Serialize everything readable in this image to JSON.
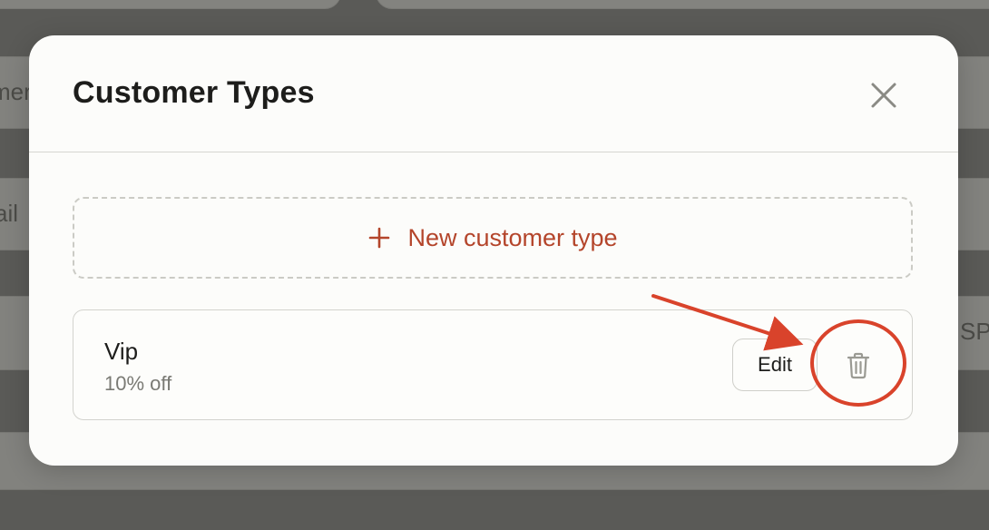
{
  "background": {
    "fragments": [
      "mer",
      "ail",
      "SP"
    ]
  },
  "modal": {
    "title": "Customer Types",
    "close_icon": "close-icon",
    "new_button": {
      "label": "New customer type",
      "icon": "plus-icon"
    },
    "customer_types": [
      {
        "name": "Vip",
        "detail": "10% off",
        "edit_label": "Edit",
        "delete_icon": "trash-icon"
      }
    ]
  },
  "colors": {
    "accent": "#b4452b",
    "annotation": "#d9432b",
    "overlay": "#7b7b79"
  }
}
